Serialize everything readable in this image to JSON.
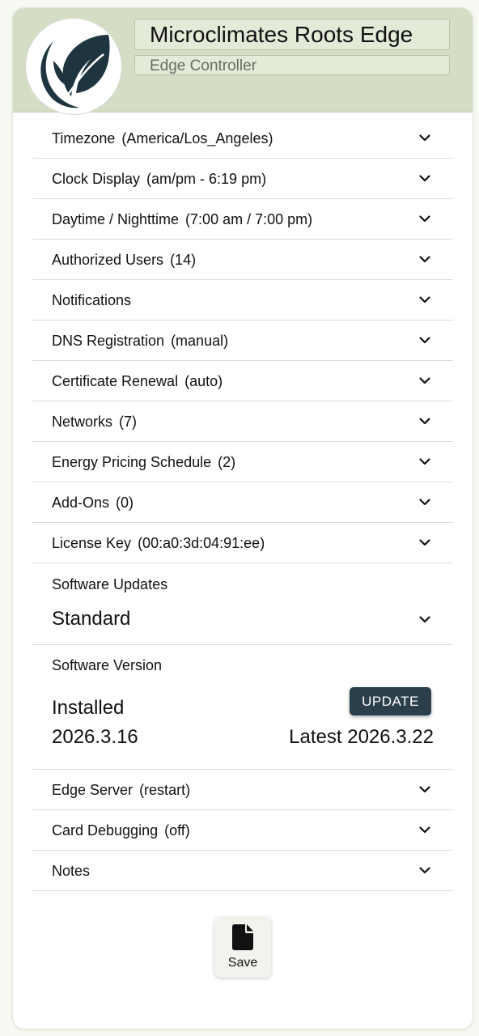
{
  "header": {
    "title": "Microclimates Roots Edge",
    "subtitle": "Edge Controller",
    "logo_icon": "leaf-logo-icon",
    "colors": {
      "header_bg": "#d4dec4",
      "logo_leaf": "#1e3540"
    }
  },
  "settings": {
    "items": [
      {
        "label": "Timezone",
        "value": "(America/Los_Angeles)"
      },
      {
        "label": "Clock Display",
        "value": "(am/pm - 6:19 pm)"
      },
      {
        "label": "Daytime / Nighttime",
        "value": "(7:00 am / 7:00 pm)"
      },
      {
        "label": "Authorized Users",
        "value": "(14)"
      },
      {
        "label": "Notifications",
        "value": ""
      },
      {
        "label": "DNS Registration",
        "value": "(manual)"
      },
      {
        "label": "Certificate Renewal",
        "value": "(auto)"
      },
      {
        "label": "Networks",
        "value": "(7)"
      },
      {
        "label": "Energy Pricing Schedule",
        "value": "(2)"
      },
      {
        "label": "Add-Ons",
        "value": "(0)"
      },
      {
        "label": "License Key",
        "value": "(00:a0:3d:04:91:ee)"
      }
    ],
    "software_updates": {
      "label": "Software Updates",
      "selected": "Standard"
    },
    "software_version": {
      "label": "Software Version",
      "installed_label": "Installed",
      "installed_version": "2026.3.16",
      "latest": "Latest 2026.3.22",
      "update_button": "UPDATE"
    },
    "items_after": [
      {
        "label": "Edge Server",
        "value": "(restart)"
      },
      {
        "label": "Card Debugging",
        "value": "(off)"
      },
      {
        "label": "Notes",
        "value": ""
      }
    ]
  },
  "save": {
    "label": "Save",
    "icon": "file-icon"
  },
  "chevron_icon": "chevron-down-icon"
}
